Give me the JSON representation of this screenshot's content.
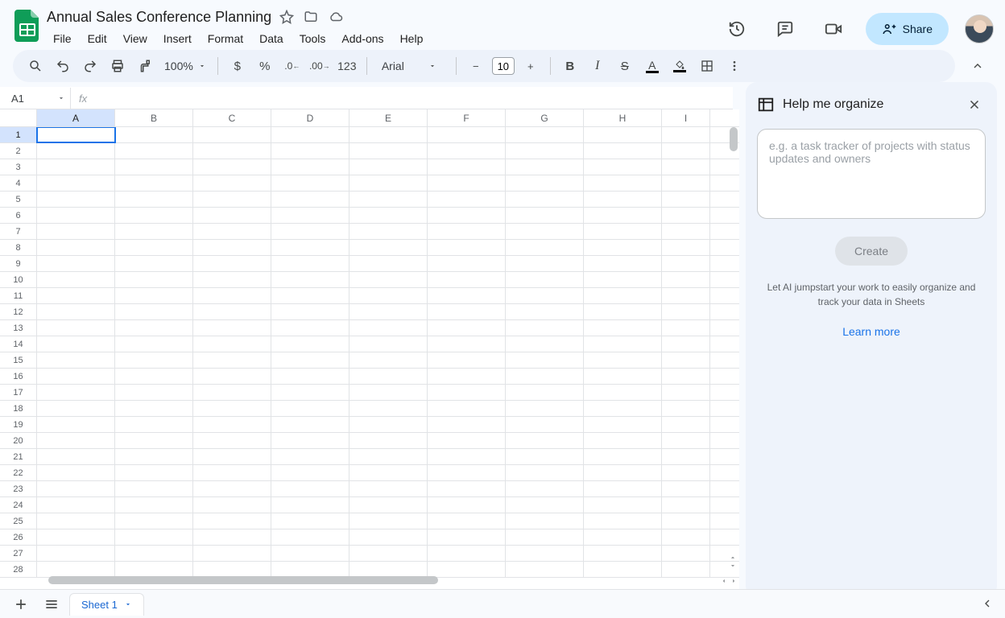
{
  "doc": {
    "title": "Annual Sales Conference Planning"
  },
  "menu": [
    "File",
    "Edit",
    "View",
    "Insert",
    "Format",
    "Data",
    "Tools",
    "Add-ons",
    "Help"
  ],
  "toolbar": {
    "zoom": "100%",
    "number_format_label": "123",
    "font_family": "Arial",
    "font_size": "10"
  },
  "actions": {
    "share": "Share"
  },
  "namebox": {
    "ref": "A1",
    "fx": "fx"
  },
  "grid": {
    "columns": [
      "A",
      "B",
      "C",
      "D",
      "E",
      "F",
      "G",
      "H",
      "I"
    ],
    "row_count": 28,
    "selected_cell": "A1"
  },
  "side_panel": {
    "title": "Help me organize",
    "placeholder": "e.g. a task tracker of projects with status updates and owners",
    "create_label": "Create",
    "note": "Let AI jumpstart your work to easily organize and track your data in Sheets",
    "learn_more": "Learn more"
  },
  "tabs": {
    "sheet1": "Sheet 1"
  }
}
